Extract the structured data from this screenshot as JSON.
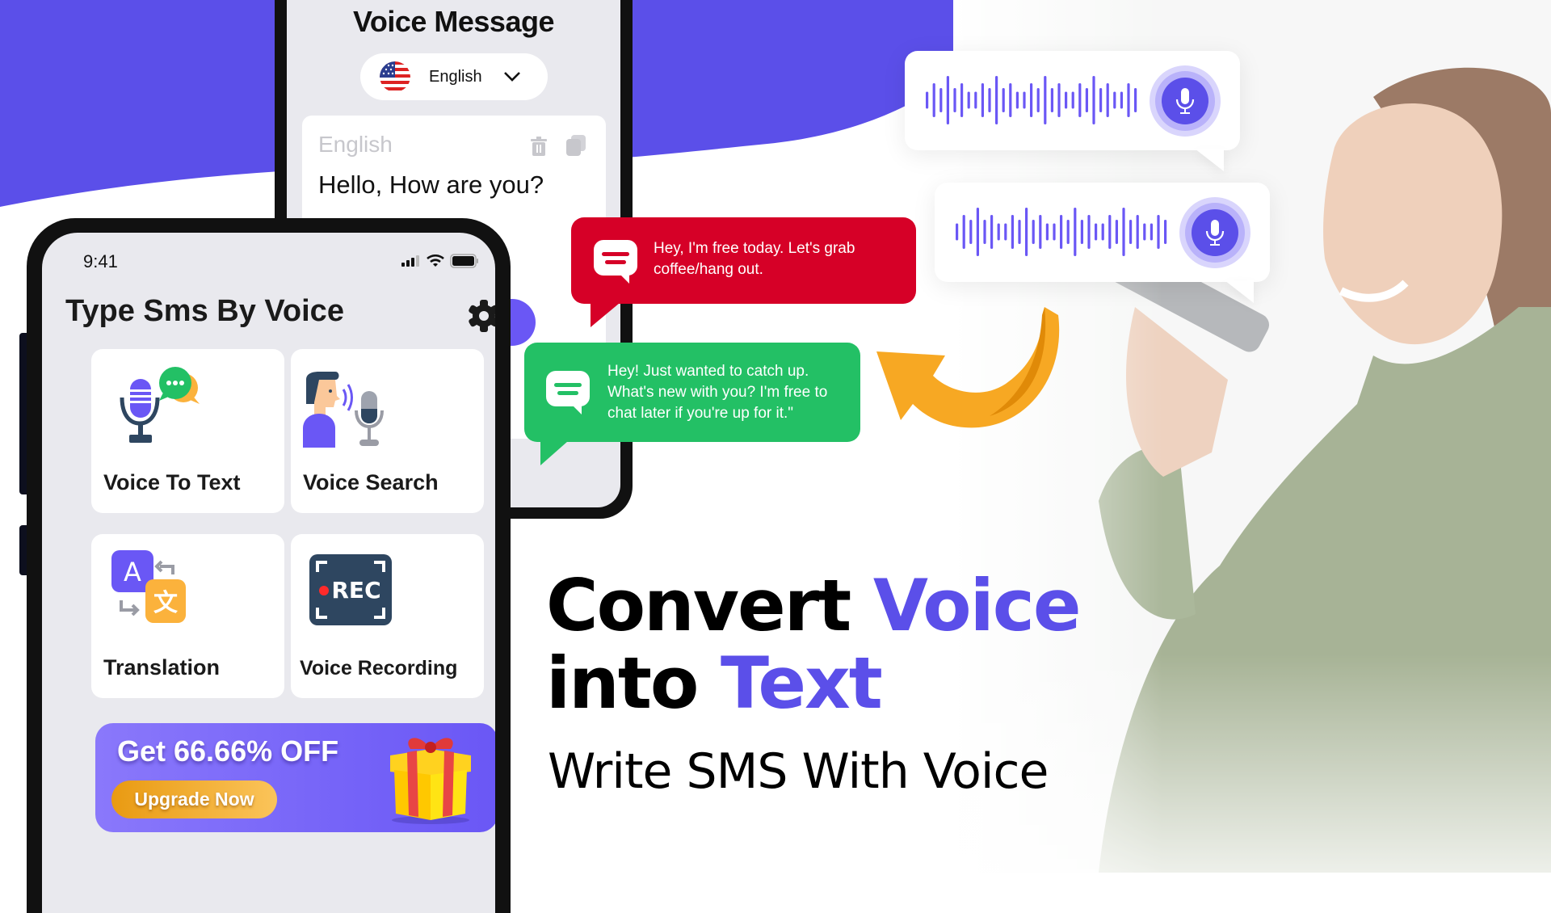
{
  "colors": {
    "brand_purple": "#5b4fe9",
    "red_bubble": "#d60027",
    "green_bubble": "#23c065",
    "orange_accent": "#f7a823"
  },
  "back_phone": {
    "title": "Voice Message",
    "language_selector": {
      "flag_icon": "us-flag-icon",
      "selected": "English",
      "chevron_icon": "chevron-down-icon"
    },
    "text_card": {
      "source_language": "English",
      "actions": [
        {
          "icon": "trash-icon"
        },
        {
          "icon": "copy-icon"
        }
      ],
      "content": "Hello, How are you?"
    }
  },
  "front_phone": {
    "status_bar": {
      "time": "9:41",
      "icons": [
        "signal-icon",
        "wifi-icon",
        "battery-icon"
      ]
    },
    "app_title": "Type Sms By Voice",
    "settings_icon": "gear-icon",
    "features": [
      {
        "label": "Voice To Text",
        "icon": "mic-chat-icon"
      },
      {
        "label": "Voice Search",
        "icon": "person-speaking-mic-icon"
      },
      {
        "label": "Translation",
        "icon": "translate-icon"
      },
      {
        "label": "Voice Recording",
        "icon": "rec-icon",
        "icon_text": "REC"
      }
    ],
    "promo": {
      "title": "Get 66.66% OFF",
      "button": "Upgrade Now",
      "icon": "gift-icon"
    }
  },
  "chat_bubbles": [
    {
      "text_lines": [
        "Hey, I'm free today. Let's grab",
        "coffee/hang out."
      ],
      "color": "red"
    },
    {
      "text_lines": [
        "Hey! Just wanted to catch up.",
        "What's new with you? I'm free to",
        "chat later if you're up for it.\""
      ],
      "color": "green"
    }
  ],
  "voice_cards": [
    {
      "icon": "microphone-icon"
    },
    {
      "icon": "microphone-icon"
    }
  ],
  "headline": {
    "line1_plain": "Convert ",
    "line1_accent": "Voice",
    "line2_plain": "into ",
    "line2_accent": "Text",
    "subtitle": "Write SMS With Voice"
  }
}
